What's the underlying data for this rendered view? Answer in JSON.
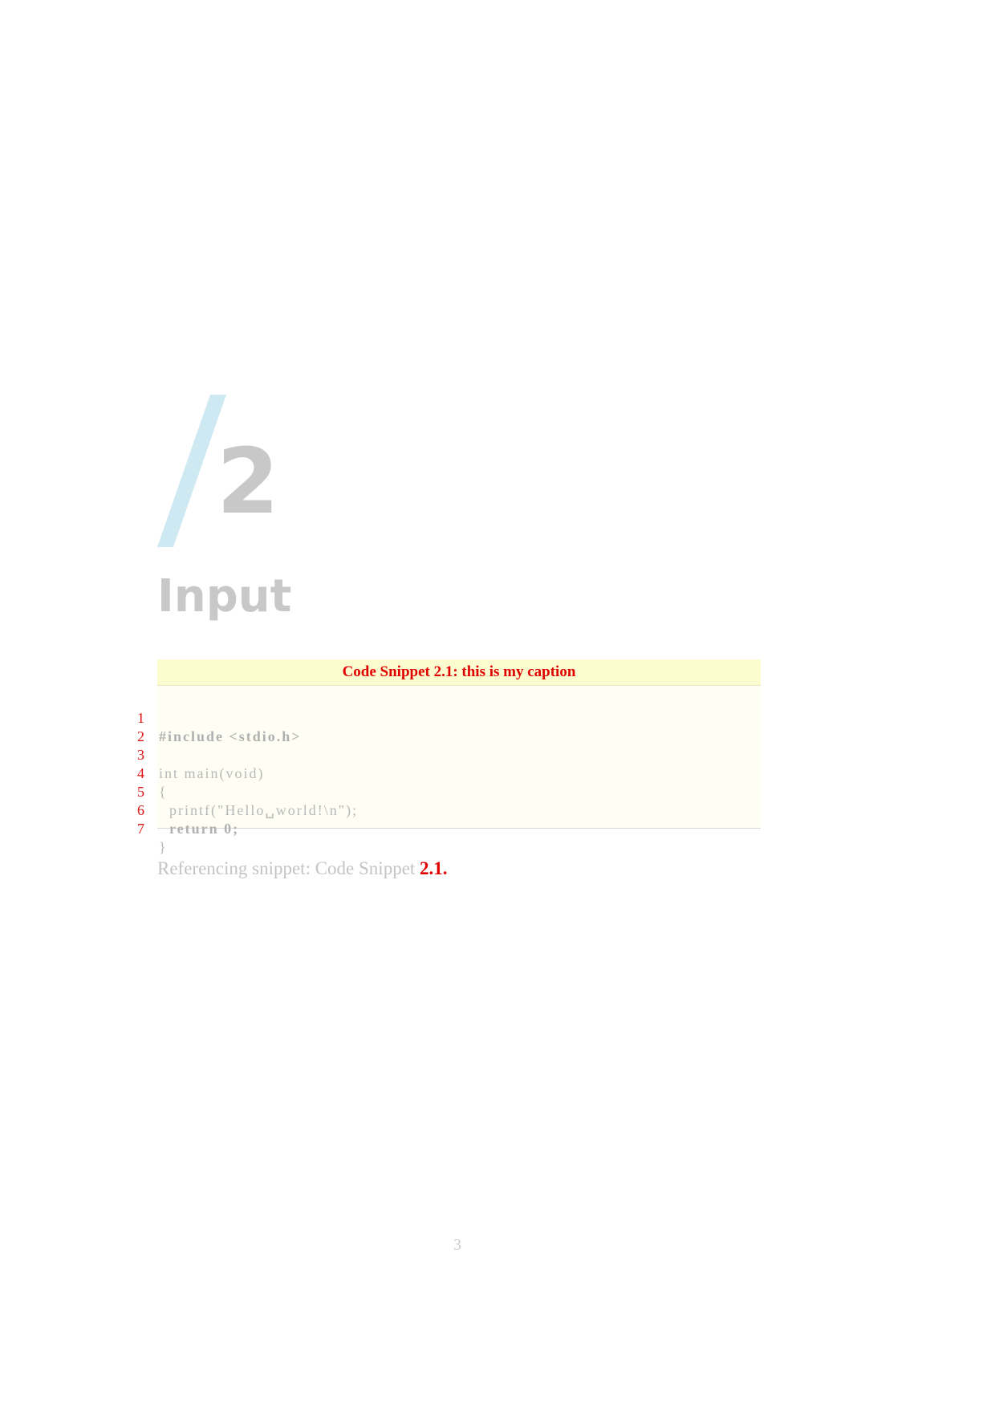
{
  "chapter": {
    "number": "2",
    "title": "Input"
  },
  "snippet": {
    "caption": "Code Snippet 2.1: this is my caption",
    "lines": [
      {
        "number": "1",
        "text": "#include <stdio.h>"
      },
      {
        "number": "2",
        "text": ""
      },
      {
        "number": "3",
        "text": "int main(void)"
      },
      {
        "number": "4",
        "text": "{"
      },
      {
        "number": "5",
        "text": "  printf(\"Hello␣world!\\n\");"
      },
      {
        "number": "6",
        "text": "  return 0;"
      },
      {
        "number": "7",
        "text": "}"
      }
    ]
  },
  "reference": {
    "prefix": "Referencing snippet: Code Snippet ",
    "link": "2.1."
  },
  "page_number": "3",
  "colors": {
    "accent_slash": "#cfe9f2",
    "heading_gray": "#c8c8c8",
    "caption_red": "#e00000",
    "caption_bg": "#fdfbd0"
  }
}
